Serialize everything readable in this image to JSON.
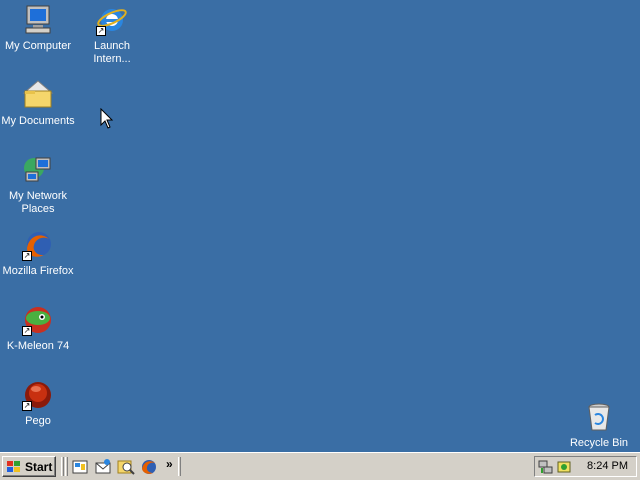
{
  "desktop": {
    "icons": [
      {
        "label": "My Computer"
      },
      {
        "label": "Launch Intern..."
      },
      {
        "label": "My Documents"
      },
      {
        "label": "My Network Places"
      },
      {
        "label": "Mozilla Firefox"
      },
      {
        "label": "K-Meleon 74"
      },
      {
        "label": "Pego"
      },
      {
        "label": "Recycle Bin"
      }
    ],
    "background_color": "#3a6ea5"
  },
  "taskbar": {
    "start_label": "Start",
    "quick_launch": [
      "show-desktop-icon",
      "outlook-express-icon",
      "search-icon",
      "firefox-icon"
    ],
    "more_label": "»",
    "clock": "8:24 PM"
  }
}
